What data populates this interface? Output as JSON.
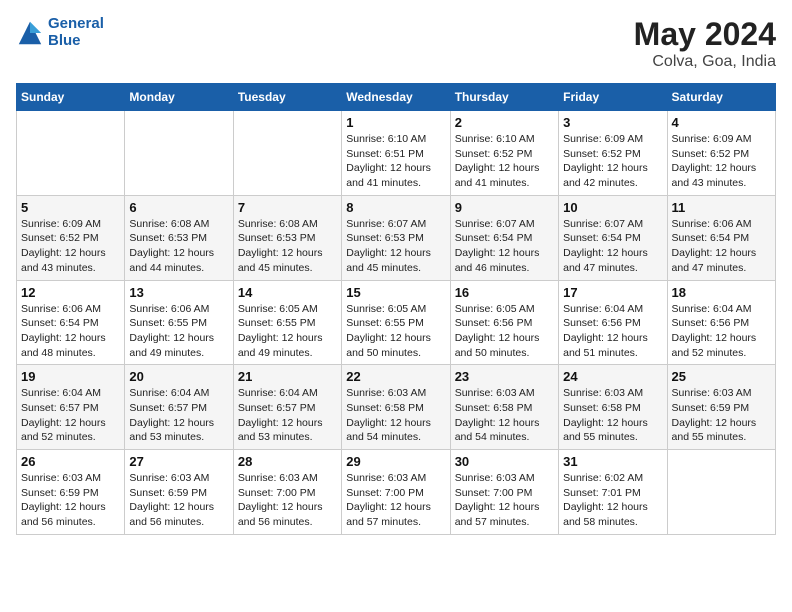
{
  "logo": {
    "line1": "General",
    "line2": "Blue"
  },
  "title": "May 2024",
  "subtitle": "Colva, Goa, India",
  "weekdays": [
    "Sunday",
    "Monday",
    "Tuesday",
    "Wednesday",
    "Thursday",
    "Friday",
    "Saturday"
  ],
  "weeks": [
    [
      {
        "day": "",
        "info": ""
      },
      {
        "day": "",
        "info": ""
      },
      {
        "day": "",
        "info": ""
      },
      {
        "day": "1",
        "info": "Sunrise: 6:10 AM\nSunset: 6:51 PM\nDaylight: 12 hours\nand 41 minutes."
      },
      {
        "day": "2",
        "info": "Sunrise: 6:10 AM\nSunset: 6:52 PM\nDaylight: 12 hours\nand 41 minutes."
      },
      {
        "day": "3",
        "info": "Sunrise: 6:09 AM\nSunset: 6:52 PM\nDaylight: 12 hours\nand 42 minutes."
      },
      {
        "day": "4",
        "info": "Sunrise: 6:09 AM\nSunset: 6:52 PM\nDaylight: 12 hours\nand 43 minutes."
      }
    ],
    [
      {
        "day": "5",
        "info": "Sunrise: 6:09 AM\nSunset: 6:52 PM\nDaylight: 12 hours\nand 43 minutes."
      },
      {
        "day": "6",
        "info": "Sunrise: 6:08 AM\nSunset: 6:53 PM\nDaylight: 12 hours\nand 44 minutes."
      },
      {
        "day": "7",
        "info": "Sunrise: 6:08 AM\nSunset: 6:53 PM\nDaylight: 12 hours\nand 45 minutes."
      },
      {
        "day": "8",
        "info": "Sunrise: 6:07 AM\nSunset: 6:53 PM\nDaylight: 12 hours\nand 45 minutes."
      },
      {
        "day": "9",
        "info": "Sunrise: 6:07 AM\nSunset: 6:54 PM\nDaylight: 12 hours\nand 46 minutes."
      },
      {
        "day": "10",
        "info": "Sunrise: 6:07 AM\nSunset: 6:54 PM\nDaylight: 12 hours\nand 47 minutes."
      },
      {
        "day": "11",
        "info": "Sunrise: 6:06 AM\nSunset: 6:54 PM\nDaylight: 12 hours\nand 47 minutes."
      }
    ],
    [
      {
        "day": "12",
        "info": "Sunrise: 6:06 AM\nSunset: 6:54 PM\nDaylight: 12 hours\nand 48 minutes."
      },
      {
        "day": "13",
        "info": "Sunrise: 6:06 AM\nSunset: 6:55 PM\nDaylight: 12 hours\nand 49 minutes."
      },
      {
        "day": "14",
        "info": "Sunrise: 6:05 AM\nSunset: 6:55 PM\nDaylight: 12 hours\nand 49 minutes."
      },
      {
        "day": "15",
        "info": "Sunrise: 6:05 AM\nSunset: 6:55 PM\nDaylight: 12 hours\nand 50 minutes."
      },
      {
        "day": "16",
        "info": "Sunrise: 6:05 AM\nSunset: 6:56 PM\nDaylight: 12 hours\nand 50 minutes."
      },
      {
        "day": "17",
        "info": "Sunrise: 6:04 AM\nSunset: 6:56 PM\nDaylight: 12 hours\nand 51 minutes."
      },
      {
        "day": "18",
        "info": "Sunrise: 6:04 AM\nSunset: 6:56 PM\nDaylight: 12 hours\nand 52 minutes."
      }
    ],
    [
      {
        "day": "19",
        "info": "Sunrise: 6:04 AM\nSunset: 6:57 PM\nDaylight: 12 hours\nand 52 minutes."
      },
      {
        "day": "20",
        "info": "Sunrise: 6:04 AM\nSunset: 6:57 PM\nDaylight: 12 hours\nand 53 minutes."
      },
      {
        "day": "21",
        "info": "Sunrise: 6:04 AM\nSunset: 6:57 PM\nDaylight: 12 hours\nand 53 minutes."
      },
      {
        "day": "22",
        "info": "Sunrise: 6:03 AM\nSunset: 6:58 PM\nDaylight: 12 hours\nand 54 minutes."
      },
      {
        "day": "23",
        "info": "Sunrise: 6:03 AM\nSunset: 6:58 PM\nDaylight: 12 hours\nand 54 minutes."
      },
      {
        "day": "24",
        "info": "Sunrise: 6:03 AM\nSunset: 6:58 PM\nDaylight: 12 hours\nand 55 minutes."
      },
      {
        "day": "25",
        "info": "Sunrise: 6:03 AM\nSunset: 6:59 PM\nDaylight: 12 hours\nand 55 minutes."
      }
    ],
    [
      {
        "day": "26",
        "info": "Sunrise: 6:03 AM\nSunset: 6:59 PM\nDaylight: 12 hours\nand 56 minutes."
      },
      {
        "day": "27",
        "info": "Sunrise: 6:03 AM\nSunset: 6:59 PM\nDaylight: 12 hours\nand 56 minutes."
      },
      {
        "day": "28",
        "info": "Sunrise: 6:03 AM\nSunset: 7:00 PM\nDaylight: 12 hours\nand 56 minutes."
      },
      {
        "day": "29",
        "info": "Sunrise: 6:03 AM\nSunset: 7:00 PM\nDaylight: 12 hours\nand 57 minutes."
      },
      {
        "day": "30",
        "info": "Sunrise: 6:03 AM\nSunset: 7:00 PM\nDaylight: 12 hours\nand 57 minutes."
      },
      {
        "day": "31",
        "info": "Sunrise: 6:02 AM\nSunset: 7:01 PM\nDaylight: 12 hours\nand 58 minutes."
      },
      {
        "day": "",
        "info": ""
      }
    ]
  ]
}
